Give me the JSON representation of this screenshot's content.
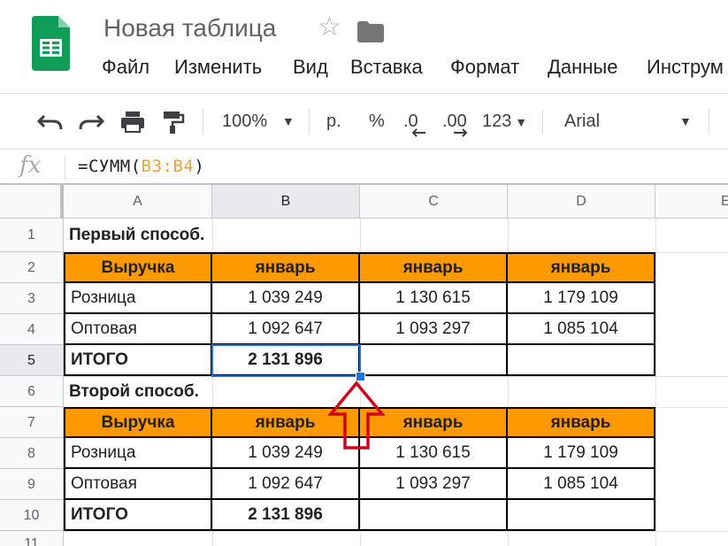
{
  "header": {
    "title": "Новая таблица",
    "menu": [
      "Файл",
      "Изменить",
      "Вид",
      "Вставка",
      "Формат",
      "Данные",
      "Инструм"
    ]
  },
  "toolbar": {
    "zoom": "100%",
    "currency": "р.",
    "percent": "%",
    "decrease_decimal": ".0",
    "increase_decimal": ".00",
    "format_more": "123",
    "font": "Arial",
    "icons": [
      "undo-icon",
      "redo-icon",
      "print-icon",
      "paint-format-icon"
    ]
  },
  "formula_bar": {
    "fx": "fx",
    "prefix": "=СУММ(",
    "range": "B3:B4",
    "suffix": ")"
  },
  "columns": [
    "A",
    "B",
    "C",
    "D",
    "E"
  ],
  "rows": [
    "1",
    "2",
    "3",
    "4",
    "5",
    "6",
    "7",
    "8",
    "9",
    "10",
    "11"
  ],
  "sheet": {
    "r1": {
      "a": "Первый способ."
    },
    "r2": {
      "a": "Выручка",
      "b": "январь",
      "c": "январь",
      "d": "январь"
    },
    "r3": {
      "a": "Розница",
      "b": "1 039 249",
      "c": "1 130 615",
      "d": "1 179 109"
    },
    "r4": {
      "a": "Оптовая",
      "b": "1 092 647",
      "c": "1 093 297",
      "d": "1 085 104"
    },
    "r5": {
      "a": "ИТОГО",
      "b": "2 131 896"
    },
    "r6": {
      "a": "Второй способ."
    },
    "r7": {
      "a": "Выручка",
      "b": "январь",
      "c": "январь",
      "d": "январь"
    },
    "r8": {
      "a": "Розница",
      "b": "1 039 249",
      "c": "1 130 615",
      "d": "1 179 109"
    },
    "r9": {
      "a": "Оптовая",
      "b": "1 092 647",
      "c": "1 093 297",
      "d": "1 085 104"
    },
    "r10": {
      "a": "ИТОГО",
      "b": "2 131 896"
    }
  },
  "selection": {
    "cell": "B5"
  },
  "colors": {
    "header_fill": "#ff9900",
    "selection": "#1a73e8",
    "arrow": "#d0021b",
    "logo": "#0f9d58"
  }
}
